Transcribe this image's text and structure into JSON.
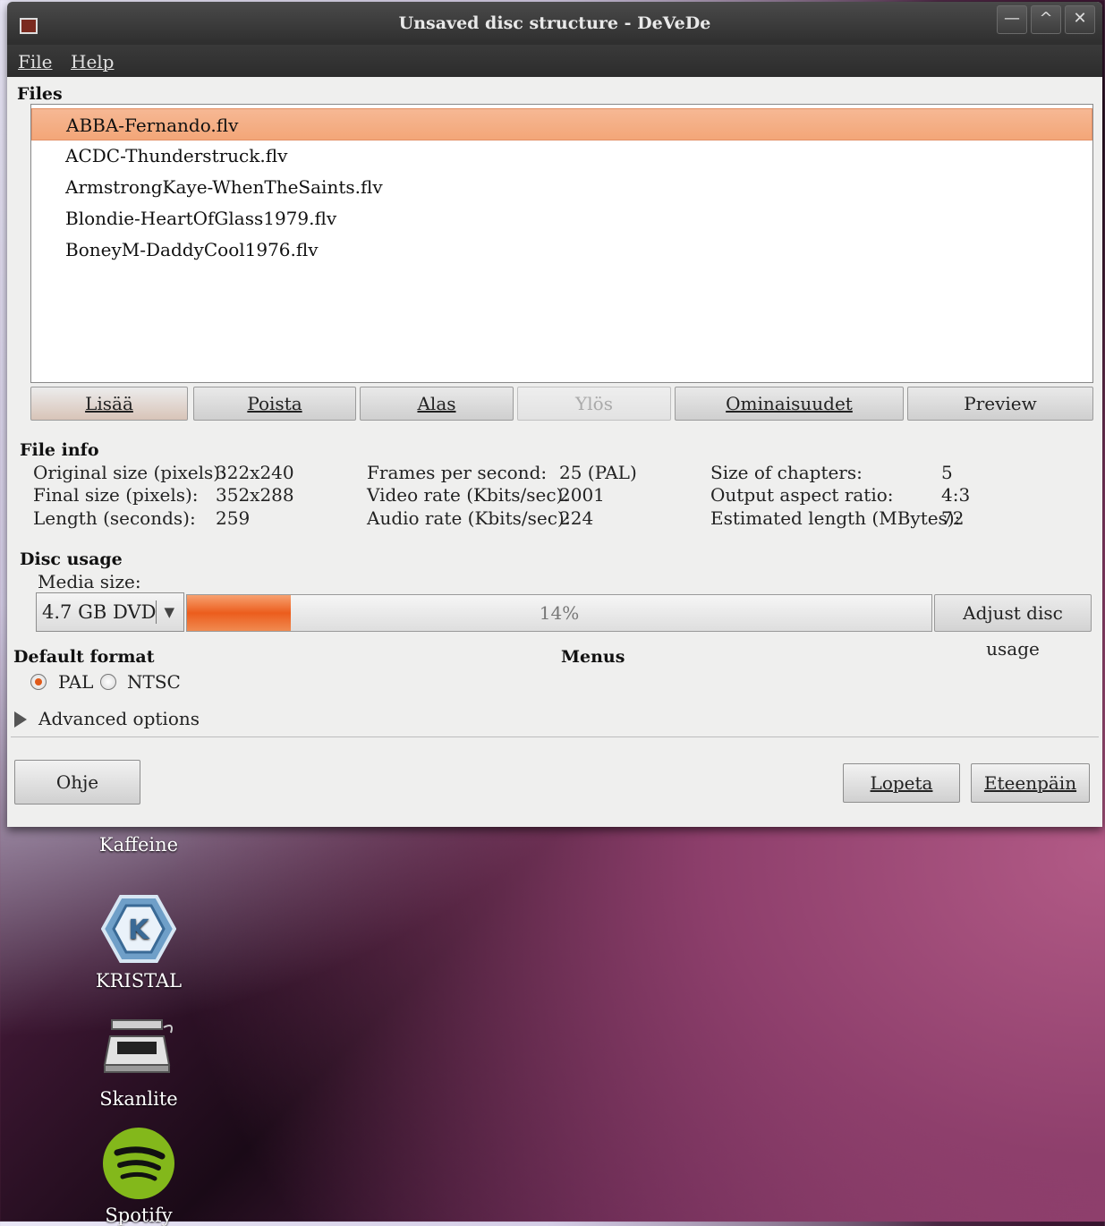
{
  "window": {
    "title": "Unsaved disc structure - DeVeDe",
    "controls": {
      "minimize": "—",
      "maximize": "^",
      "close": "✕"
    }
  },
  "menu": {
    "file": "File",
    "help": "Help"
  },
  "files": {
    "heading": "Files",
    "items": [
      "ABBA-Fernando.flv",
      "ACDC-Thunderstruck.flv",
      "ArmstrongKaye-WhenTheSaints.flv",
      "Blondie-HeartOfGlass1979.flv",
      "BoneyM-DaddyCool1976.flv"
    ],
    "selected_index": 0
  },
  "file_buttons": {
    "add": "Lisää",
    "remove": "Poista",
    "down": "Alas",
    "up": "Ylös",
    "properties": "Ominaisuudet",
    "preview": "Preview"
  },
  "file_info": {
    "heading": "File info",
    "original_size_label": "Original size (pixels):",
    "original_size": "322x240",
    "final_size_label": "Final size (pixels):",
    "final_size": "352x288",
    "length_label": "Length (seconds):",
    "length": "259",
    "fps_label": "Frames per second:",
    "fps": "25 (PAL)",
    "video_rate_label": "Video rate (Kbits/sec):",
    "video_rate": "2001",
    "audio_rate_label": "Audio rate (Kbits/sec):",
    "audio_rate": "224",
    "chapters_label": "Size of chapters:",
    "chapters": "5",
    "aspect_label": "Output aspect ratio:",
    "aspect": "4:3",
    "estimated_label": "Estimated length (MBytes):",
    "estimated": "72"
  },
  "disc_usage": {
    "heading": "Disc usage",
    "media_label": "Media size:",
    "media_value": "4.7 GB DVD",
    "percent_text": "14%",
    "percent": 14,
    "adjust_button": "Adjust disc usage"
  },
  "format": {
    "heading": "Default format",
    "pal": "PAL",
    "ntsc": "NTSC",
    "selected": "PAL"
  },
  "menus_heading": "Menus",
  "advanced_label": "Advanced options",
  "bottom_buttons": {
    "help": "Ohje",
    "quit": "Lopeta",
    "forward": "Eteenpäin"
  },
  "desktop_icons": {
    "kaffeine": "Kaffeine",
    "kristal": "KRISTAL",
    "skanlite": "Skanlite",
    "spotify": "Spotify"
  },
  "colors": {
    "selection": "#f3a678",
    "progress": "#ec5d1d",
    "radio_active": "#e05a1a"
  }
}
